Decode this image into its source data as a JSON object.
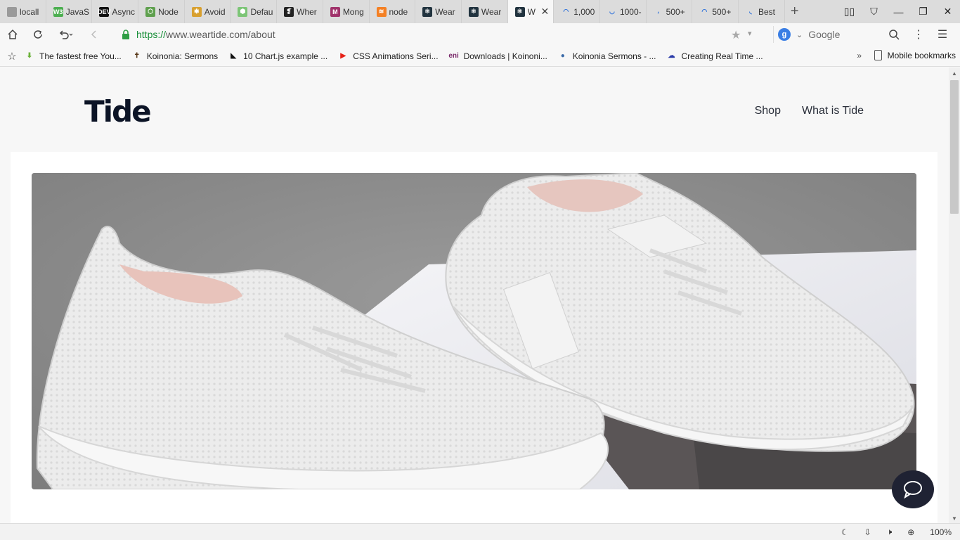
{
  "browser": {
    "tabs": [
      {
        "title": "locall",
        "icon": "file-icon",
        "color": "#9a9a9a",
        "glyph": ""
      },
      {
        "title": "JavaS",
        "icon": "w3schools-icon",
        "color": "#4caf50",
        "glyph": "W3"
      },
      {
        "title": "Async",
        "icon": "dev-icon",
        "color": "#111111",
        "glyph": "DEV"
      },
      {
        "title": "Node",
        "icon": "node-icon",
        "color": "#5fa04e",
        "glyph": "⬡"
      },
      {
        "title": "Avoid",
        "icon": "sun-icon",
        "color": "#d8a030",
        "glyph": "✱"
      },
      {
        "title": "Defau",
        "icon": "shield-icon",
        "color": "#7cc576",
        "glyph": "⬢"
      },
      {
        "title": "Wher",
        "icon": "quote-icon",
        "color": "#222222",
        "glyph": "❡"
      },
      {
        "title": "Mong",
        "icon": "m-icon",
        "color": "#a0336b",
        "glyph": "M"
      },
      {
        "title": "node",
        "icon": "stack-icon",
        "color": "#f48024",
        "glyph": "≋"
      },
      {
        "title": "Wear",
        "icon": "react-icon",
        "color": "#21333f",
        "glyph": "⚛"
      },
      {
        "title": "Wear",
        "icon": "react-icon",
        "color": "#21333f",
        "glyph": "⚛"
      },
      {
        "title": "W",
        "icon": "react-icon",
        "color": "#21333f",
        "glyph": "⚛",
        "active": true
      },
      {
        "title": "1,000",
        "icon": "loading-icon",
        "color": "#2a6fdb",
        "glyph": "◠"
      },
      {
        "title": "1000-",
        "icon": "loading-icon",
        "color": "#2a6fdb",
        "glyph": "◡"
      },
      {
        "title": "500+",
        "icon": "loading-icon",
        "color": "#2a6fdb",
        "glyph": "،"
      },
      {
        "title": "500+",
        "icon": "loading-icon",
        "color": "#2a6fdb",
        "glyph": "◠"
      },
      {
        "title": "Best",
        "icon": "loading-icon",
        "color": "#2a6fdb",
        "glyph": "◟"
      }
    ],
    "url_scheme": "https://",
    "url_rest": "www.weartide.com/about",
    "search_engine": "Google",
    "zoom": "100%",
    "bookmarks": [
      {
        "label": "The fastest free You...",
        "icon": "download-arrow-icon",
        "color": "#6bb23a",
        "glyph": "⬇"
      },
      {
        "label": "Koinonia: Sermons",
        "icon": "cross-icon",
        "color": "#5a3a1a",
        "glyph": "✝"
      },
      {
        "label": "10 Chart.js example ...",
        "icon": "tutorial-icon",
        "color": "#111111",
        "glyph": "◣"
      },
      {
        "label": "CSS Animations Seri...",
        "icon": "youtube-icon",
        "color": "#e62117",
        "glyph": "▶"
      },
      {
        "label": "Downloads | Koinoni...",
        "icon": "eni-icon",
        "color": "#7a2a6a",
        "glyph": "eni"
      },
      {
        "label": "Koinonia Sermons - ...",
        "icon": "globe-icon",
        "color": "#3a6aa8",
        "glyph": "●"
      },
      {
        "label": "Creating Real Time ...",
        "icon": "cloud-icon",
        "color": "#2a3aa8",
        "glyph": "☁"
      }
    ],
    "mobile_bookmarks": "Mobile bookmarks"
  },
  "site": {
    "logo": "Tide",
    "nav": [
      "Shop",
      "What is Tide"
    ]
  },
  "colors": {
    "brand_dark": "#0c1426",
    "chat_bubble": "#1f2233",
    "secure_green": "#1a8f3a"
  }
}
